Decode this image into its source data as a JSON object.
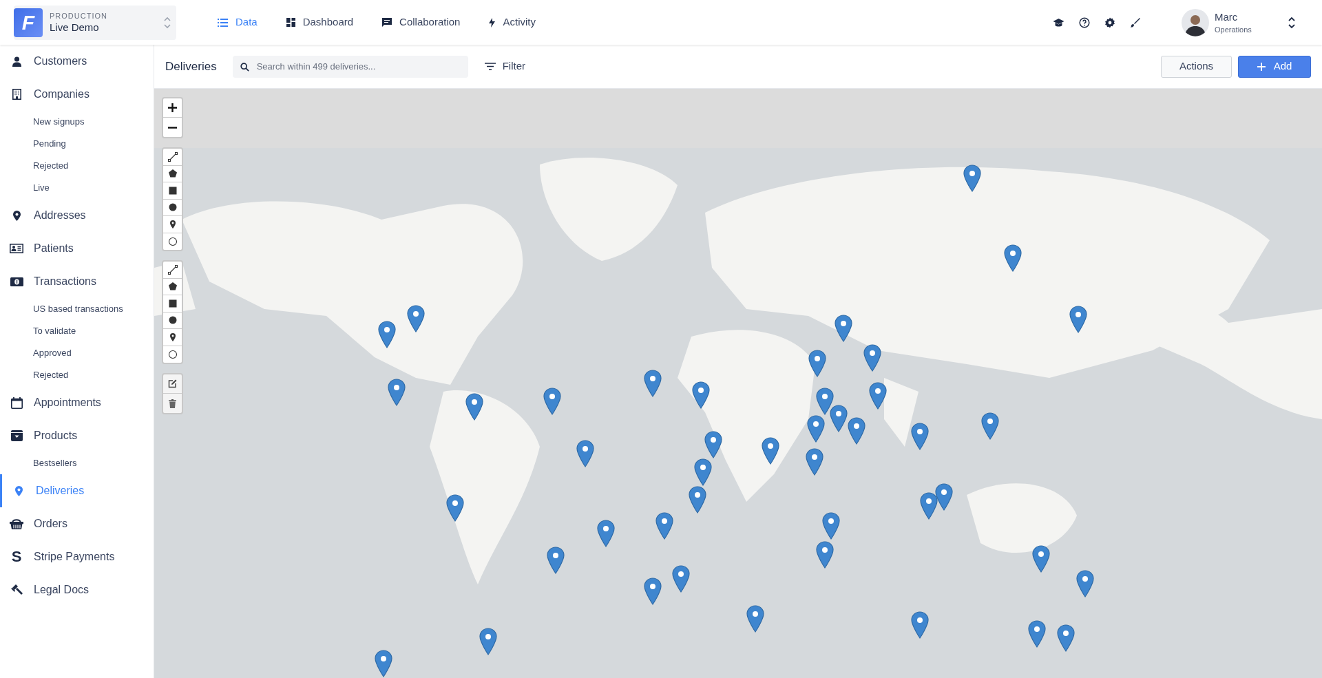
{
  "workspace": {
    "logo_text": "F",
    "environment": "PRODUCTION",
    "name": "Live Demo"
  },
  "nav_tabs": [
    {
      "label": "Data",
      "selected": true
    },
    {
      "label": "Dashboard",
      "selected": false
    },
    {
      "label": "Collaboration",
      "selected": false
    },
    {
      "label": "Activity",
      "selected": false
    }
  ],
  "user": {
    "name": "Marc",
    "role": "Operations"
  },
  "sidebar": {
    "items": [
      {
        "label": "Customers",
        "selected": false
      },
      {
        "label": "Companies",
        "selected": false,
        "children": [
          {
            "label": "New signups",
            "selected": false
          },
          {
            "label": "Pending",
            "selected": false
          },
          {
            "label": "Rejected",
            "selected": false
          },
          {
            "label": "Live",
            "selected": false
          }
        ]
      },
      {
        "label": "Addresses",
        "selected": false
      },
      {
        "label": "Patients",
        "selected": false
      },
      {
        "label": "Transactions",
        "selected": false,
        "children": [
          {
            "label": "US based transactions",
            "selected": false
          },
          {
            "label": "To validate",
            "selected": false
          },
          {
            "label": "Approved",
            "selected": false
          },
          {
            "label": "Rejected",
            "selected": false
          }
        ]
      },
      {
        "label": "Appointments",
        "selected": false
      },
      {
        "label": "Products",
        "selected": false,
        "children": [
          {
            "label": "Bestsellers",
            "selected": false
          }
        ]
      },
      {
        "label": "Deliveries",
        "selected": true
      },
      {
        "label": "Orders",
        "selected": false
      },
      {
        "label": "Stripe Payments",
        "selected": false,
        "icon_glyph": "S"
      },
      {
        "label": "Legal Docs",
        "selected": false
      }
    ]
  },
  "toolbar": {
    "title": "Deliveries",
    "search": {
      "placeholder": "Search within 499 deliveries..."
    },
    "filter": "Filter",
    "buttons": [
      {
        "label": "Actions",
        "kind": "secondary"
      },
      {
        "label": "Add",
        "kind": "primary"
      }
    ]
  }
}
